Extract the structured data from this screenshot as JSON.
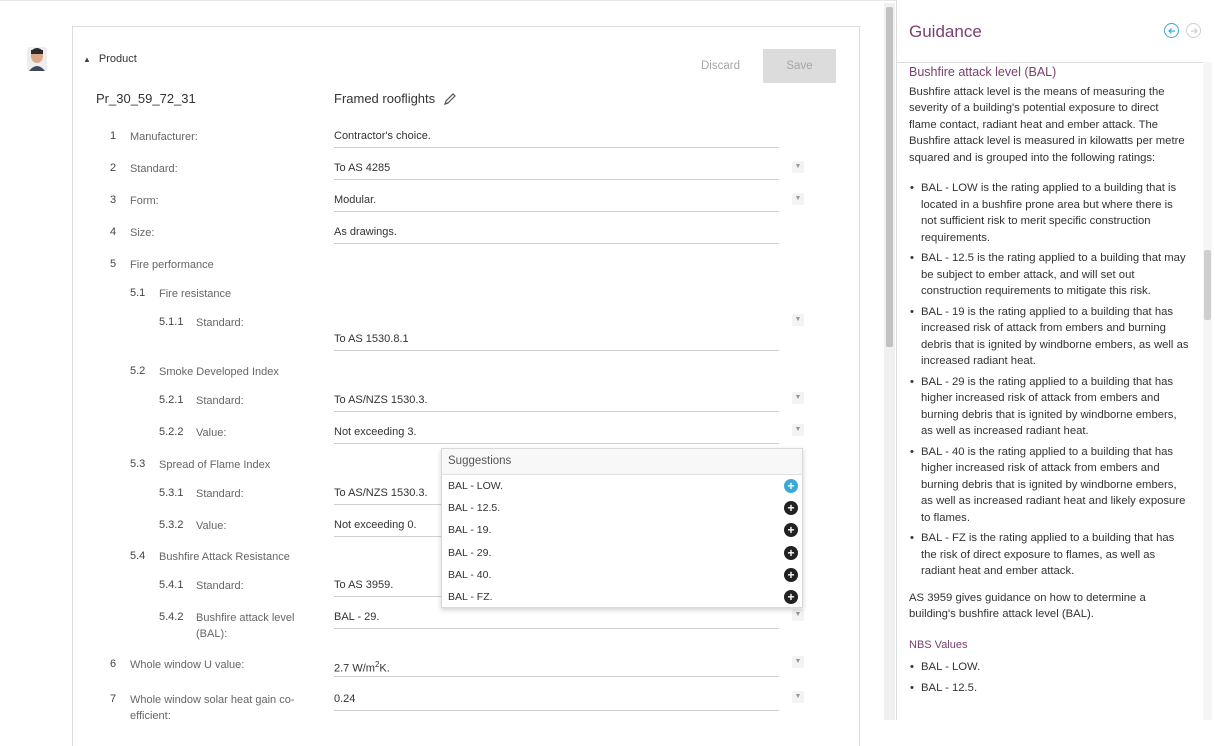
{
  "product": {
    "section_label": "Product",
    "discard_label": "Discard",
    "save_label": "Save",
    "code": "Pr_30_59_72_31",
    "title": "Framed rooflights"
  },
  "clauses": [
    {
      "num": "1",
      "label": "Manufacturer:",
      "value": "Contractor's choice."
    },
    {
      "num": "2",
      "label": "Standard:",
      "value": "To AS 4285"
    },
    {
      "num": "3",
      "label": "Form:",
      "value": "Modular."
    },
    {
      "num": "4",
      "label": "Size:",
      "value": "As drawings."
    },
    {
      "num": "5",
      "label": "Fire performance"
    },
    {
      "num": "5.1",
      "label": "Fire resistance"
    },
    {
      "num": "5.1.1",
      "label": "Standard:",
      "value": "To AS 1530.8.1"
    },
    {
      "num": "5.2",
      "label": "Smoke Developed Index"
    },
    {
      "num": "5.2.1",
      "label": "Standard:",
      "value": "To AS/NZS 1530.3."
    },
    {
      "num": "5.2.2",
      "label": "Value:",
      "value": "Not exceeding 3."
    },
    {
      "num": "5.3",
      "label": "Spread of Flame Index"
    },
    {
      "num": "5.3.1",
      "label": "Standard:",
      "value": "To AS/NZS 1530.3."
    },
    {
      "num": "5.3.2",
      "label": "Value:",
      "value": "Not exceeding 0."
    },
    {
      "num": "5.4",
      "label": "Bushfire Attack Resistance"
    },
    {
      "num": "5.4.1",
      "label": "Standard:",
      "value": "To AS 3959."
    },
    {
      "num": "5.4.2",
      "label": "Bushfire attack level (BAL):",
      "value": "BAL - 29."
    },
    {
      "num": "6",
      "label": "Whole window U value:",
      "value_main": "2.7 W/m",
      "value_sup": "2",
      "value_end": "K."
    },
    {
      "num": "7",
      "label": "Whole window solar heat gain co-efficient:",
      "value": "0.24"
    }
  ],
  "suggestions": {
    "header": "Suggestions",
    "items": [
      "BAL - LOW.",
      "BAL - 12.5.",
      "BAL - 19.",
      "BAL - 29.",
      "BAL - 40.",
      "BAL - FZ."
    ]
  },
  "guidance": {
    "title": "Guidance",
    "subtitle": "Bushfire attack level (BAL)",
    "intro": "Bushfire attack level is the means of measuring the severity of a building's potential exposure to direct flame contact, radiant heat and ember attack. The Bushfire attack level is measured in kilowatts per metre squared and is grouped into the following ratings:",
    "ratings": [
      "BAL - LOW is the rating applied to a building that is located in a bushfire prone area but where there is not sufficient risk to merit specific construction requirements.",
      "BAL - 12.5 is the rating applied to a building that may be subject to ember attack, and will set out construction requirements to mitigate this risk.",
      "BAL - 19 is the rating applied to a building that has increased risk of attack from embers and burning debris that is ignited by windborne embers, as well as increased radiant heat.",
      "BAL - 29 is the rating applied to a building that has higher increased risk of attack from embers and burning debris that is ignited by windborne embers, as well as increased radiant heat.",
      "BAL - 40 is the rating applied to a building that has higher increased risk of attack from embers and burning debris that is ignited by windborne embers, as well as increased radiant heat and likely exposure to flames.",
      "BAL - FZ is the rating applied to a building that has the risk of direct exposure to flames, as well as radiant heat and ember attack."
    ],
    "note": "AS 3959 gives guidance on how to determine a building's bushfire attack level (BAL).",
    "values_heading": "NBS Values",
    "values": [
      "BAL - LOW.",
      "BAL - 12.5."
    ]
  },
  "colors": {
    "accent": "#3aa9d9",
    "heading": "#7a3f6e"
  }
}
